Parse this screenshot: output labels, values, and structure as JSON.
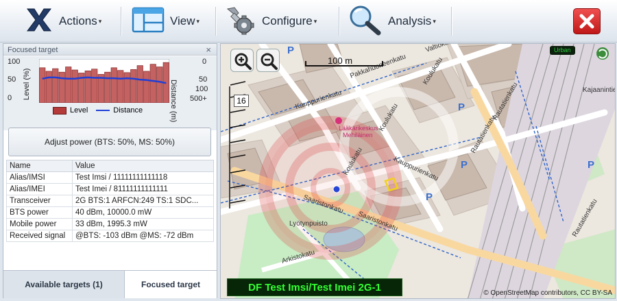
{
  "toolbar": {
    "actions_label": "Actions",
    "view_label": "View",
    "configure_label": "Configure",
    "analysis_label": "Analysis"
  },
  "panel": {
    "title": "Focused target",
    "chart": {
      "y_left_label": "Level (%)",
      "y_left_ticks": [
        "100",
        "50",
        "0"
      ],
      "y_right_label": "Distance (m)",
      "y_right_ticks": [
        "0",
        "50",
        "100",
        "500+"
      ],
      "legend": [
        "Level",
        "Distance"
      ],
      "level_values": [
        80,
        72,
        78,
        70,
        82,
        75,
        68,
        73,
        77,
        65,
        70,
        80,
        74,
        69,
        76,
        85,
        72,
        88,
        82,
        92
      ],
      "distance_values": [
        55,
        58,
        58,
        56,
        55,
        55,
        57,
        58,
        57,
        57,
        56,
        56,
        55,
        56,
        55,
        53,
        52,
        50,
        48,
        45
      ],
      "level_color": "#b53a3a",
      "distance_color": "#1f3fd6"
    },
    "adjust_button": "Adjust power (BTS: 50%, MS: 50%)",
    "table": {
      "headers": [
        "Name",
        "Value"
      ],
      "rows": [
        [
          "Alias/IMSI",
          "Test Imsi / 11111111111118"
        ],
        [
          "Alias/IMEI",
          "Test Imei / 81111111111111"
        ],
        [
          "Transceiver",
          "2G BTS:1 ARFCN:249 TS:1 SDC..."
        ],
        [
          "BTS power",
          "40 dBm, 10000.0 mW"
        ],
        [
          "Mobile power",
          "33 dBm, 1995.3 mW"
        ],
        [
          "Received signal",
          "@BTS: -103 dBm @MS: -72 dBm"
        ]
      ]
    },
    "tabs": [
      "Available targets (1)",
      "Focused target"
    ]
  },
  "map": {
    "scale": "100 m",
    "zoom_level": "16",
    "environment": "Urban",
    "target_label": "DF Test Imsi/Test Imei 2G-1",
    "attribution": "© OpenStreetMap contributors, CC BY-SA",
    "streets": [
      "Pakkahuoneenkatu",
      "Kauppurienkatu",
      "Koulukatu",
      "Saaristonkatu",
      "Lyötynpuisto",
      "Arkistokatu",
      "Rautatienkatu",
      "Kajaanintie",
      "Läkärikeskus Mehiläinen",
      "Kauppurienkatu"
    ]
  }
}
